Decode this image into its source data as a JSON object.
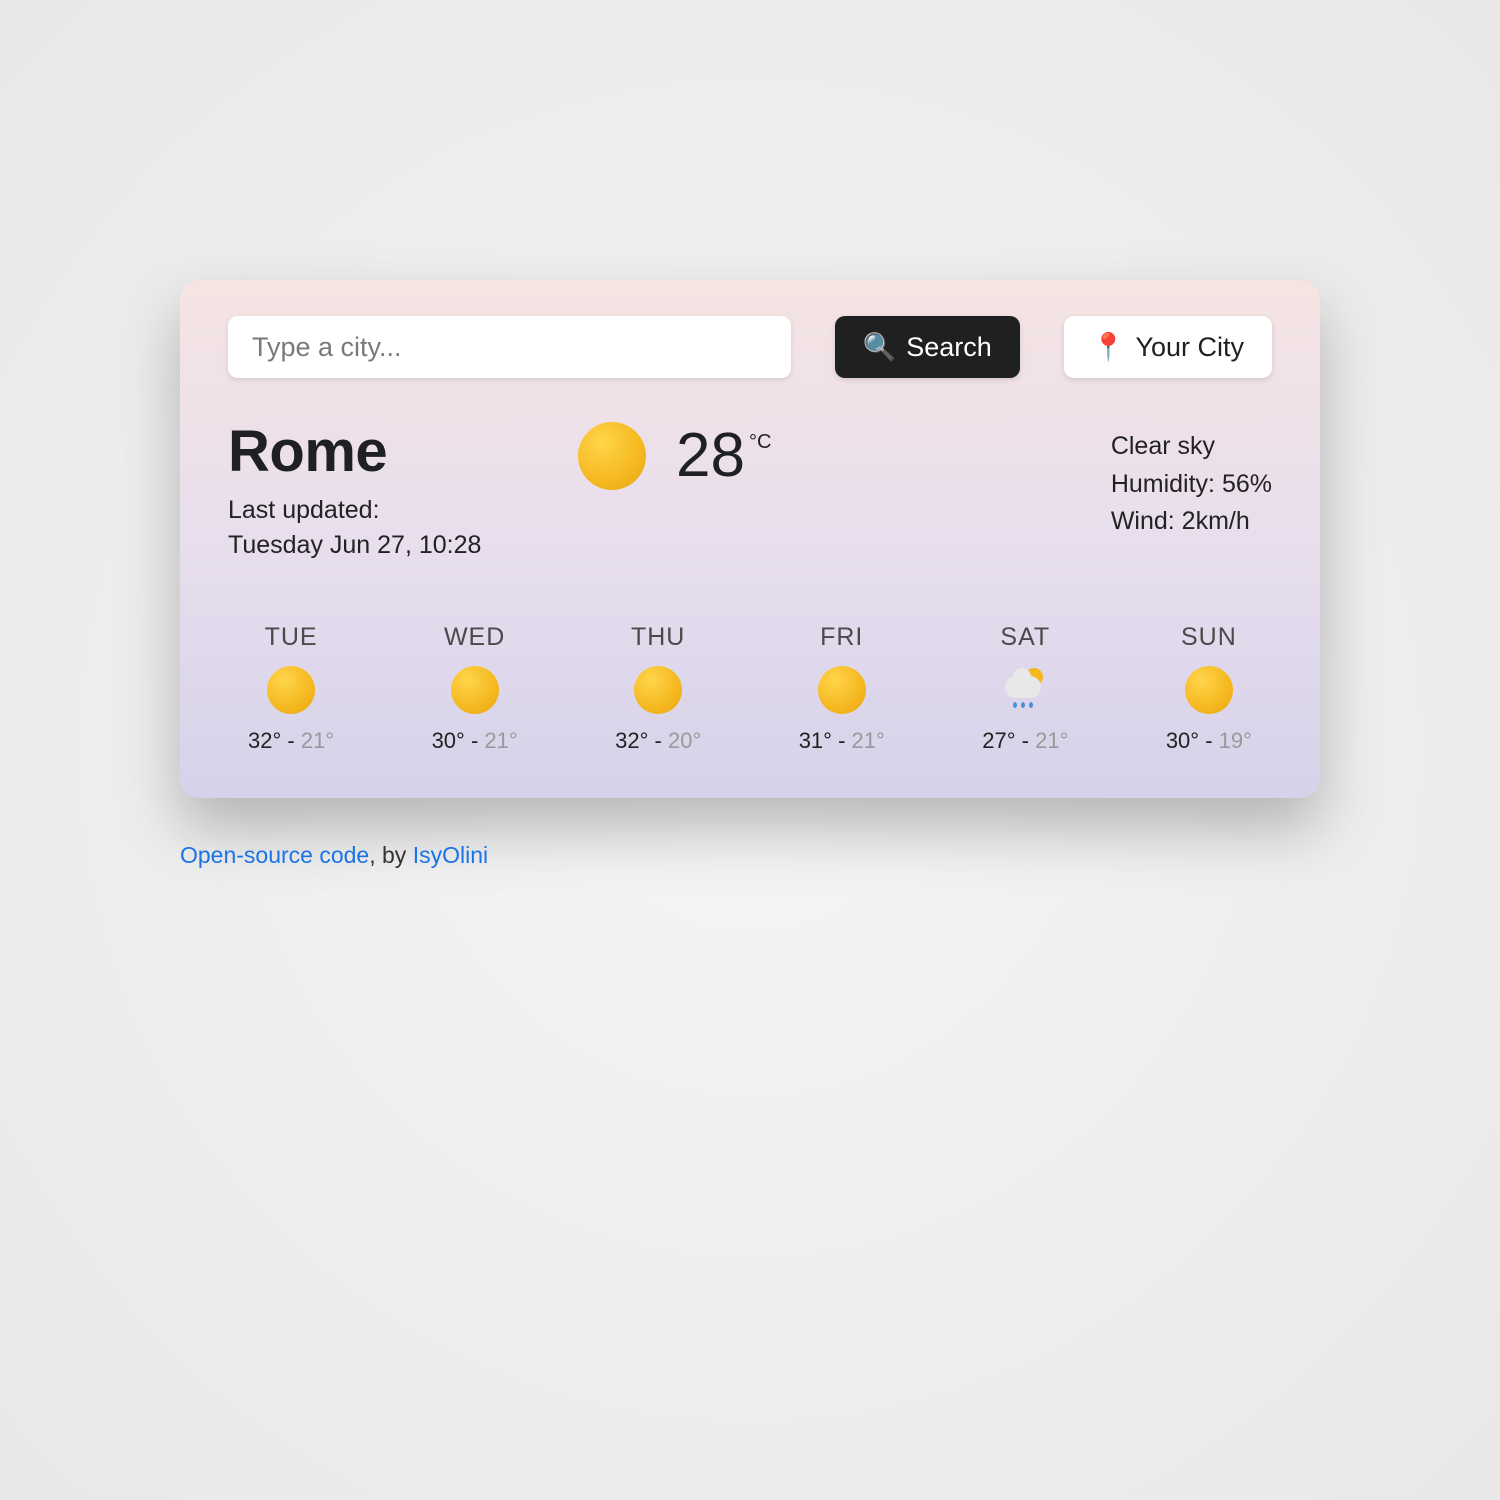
{
  "search": {
    "placeholder": "Type a city...",
    "search_button": "Search",
    "search_icon": "🔍",
    "your_city_button": "Your City",
    "pin_icon": "📍"
  },
  "current": {
    "city": "Rome",
    "updated_label": "Last updated:",
    "updated_time": "Tuesday Jun 27, 10:28",
    "temp": "28",
    "unit": "°C",
    "condition": "Clear sky",
    "humidity_label": "Humidity: ",
    "humidity_value": "56%",
    "wind_label": "Wind: ",
    "wind_value": "2km/h",
    "icon": "sun"
  },
  "forecast": [
    {
      "day": "TUE",
      "icon": "sun",
      "hi": "32°",
      "lo": "21°"
    },
    {
      "day": "WED",
      "icon": "sun",
      "hi": "30°",
      "lo": "21°"
    },
    {
      "day": "THU",
      "icon": "sun",
      "hi": "32°",
      "lo": "20°"
    },
    {
      "day": "FRI",
      "icon": "sun",
      "hi": "31°",
      "lo": "21°"
    },
    {
      "day": "SAT",
      "icon": "rain",
      "hi": "27°",
      "lo": "21°"
    },
    {
      "day": "SUN",
      "icon": "sun",
      "hi": "30°",
      "lo": "19°"
    }
  ],
  "credits": {
    "code_link": "Open-source code",
    "by": ", by ",
    "author": "IsyOlini"
  }
}
